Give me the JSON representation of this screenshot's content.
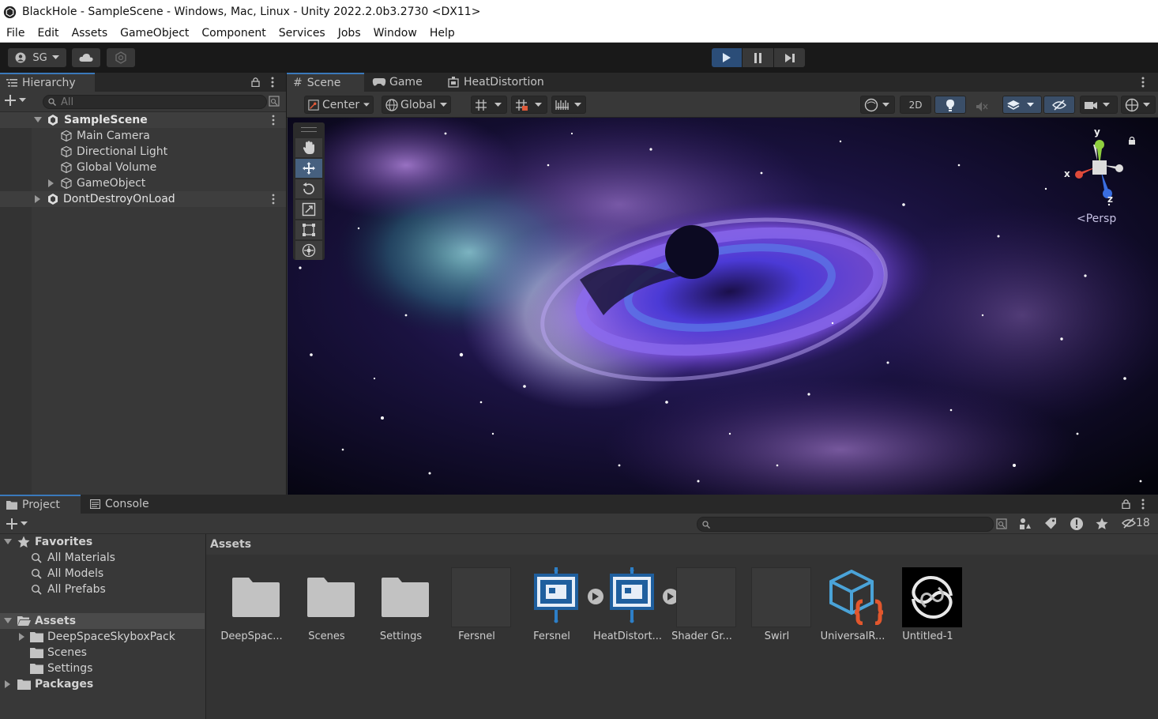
{
  "window": {
    "title": "BlackHole - SampleScene - Windows, Mac, Linux - Unity 2022.2.0b3.2730 <DX11>"
  },
  "menu": [
    "File",
    "Edit",
    "Assets",
    "GameObject",
    "Component",
    "Services",
    "Jobs",
    "Window",
    "Help"
  ],
  "toolbar": {
    "account": "SG"
  },
  "hierarchy": {
    "tab": "Hierarchy",
    "search_placeholder": "All",
    "items": [
      {
        "label": "SampleScene",
        "kind": "scene"
      },
      {
        "label": "Main Camera",
        "kind": "object"
      },
      {
        "label": "Directional Light",
        "kind": "object"
      },
      {
        "label": "Global Volume",
        "kind": "object"
      },
      {
        "label": "GameObject",
        "kind": "object"
      },
      {
        "label": "DontDestroyOnLoad",
        "kind": "scene"
      }
    ]
  },
  "scene": {
    "tabs": [
      "Scene",
      "Game",
      "HeatDistortion"
    ],
    "pivot": "Center",
    "space": "Global",
    "mode_2d": "2D",
    "persp": "Persp",
    "gizmo_axes": {
      "x": "x",
      "y": "y",
      "z": "z"
    }
  },
  "project": {
    "tabs": [
      "Project",
      "Console"
    ],
    "hidden_count": "18",
    "tree": [
      {
        "label": "Favorites",
        "kind": "fav-root"
      },
      {
        "label": "All Materials",
        "kind": "search"
      },
      {
        "label": "All Models",
        "kind": "search"
      },
      {
        "label": "All Prefabs",
        "kind": "search"
      },
      {
        "label": "Assets",
        "kind": "root"
      },
      {
        "label": "DeepSpaceSkyboxPack",
        "kind": "folder"
      },
      {
        "label": "Scenes",
        "kind": "folder"
      },
      {
        "label": "Settings",
        "kind": "folder"
      },
      {
        "label": "Packages",
        "kind": "root"
      }
    ],
    "breadcrumb": "Assets",
    "assets": [
      {
        "label": "DeepSpac...",
        "type": "folder"
      },
      {
        "label": "Scenes",
        "type": "folder"
      },
      {
        "label": "Settings",
        "type": "folder"
      },
      {
        "label": "Fersnel",
        "type": "material"
      },
      {
        "label": "Fersnel",
        "type": "shadergraph"
      },
      {
        "label": "HeatDistort...",
        "type": "shadergraph"
      },
      {
        "label": "Shader Gr...",
        "type": "material"
      },
      {
        "label": "Swirl",
        "type": "material"
      },
      {
        "label": "UniversalR...",
        "type": "pipeline"
      },
      {
        "label": "Untitled-1",
        "type": "texture"
      }
    ]
  }
}
